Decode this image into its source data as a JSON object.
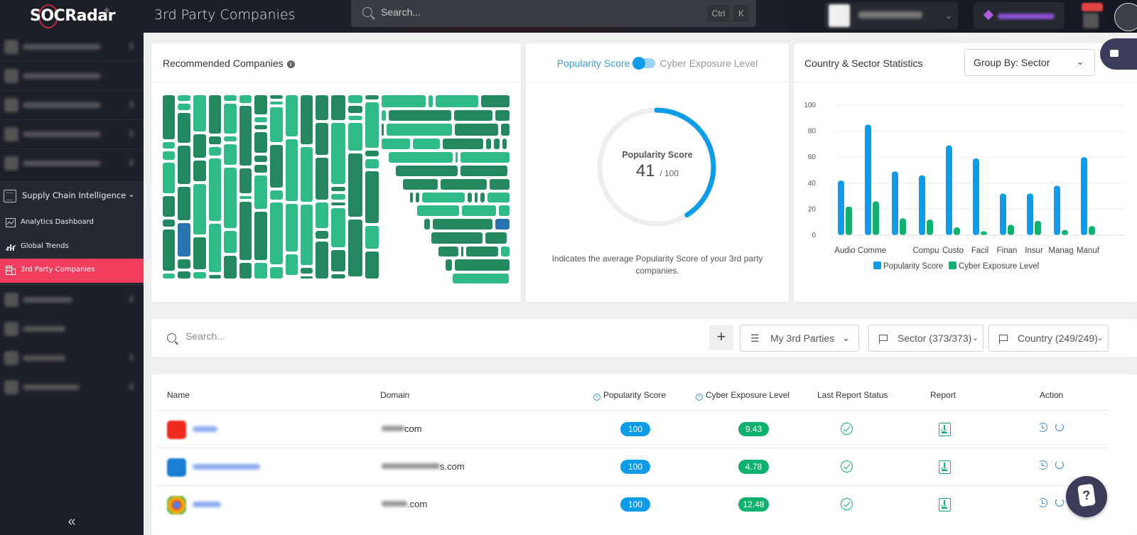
{
  "topbar": {
    "logo": "SOCRadar",
    "logo_mark": "®",
    "page_title": "3rd Party Companies",
    "search_placeholder": "Search...",
    "shortcut_ctrl": "Ctrl",
    "shortcut_key": "K"
  },
  "sidebar": {
    "blurred_items_top": 5,
    "section": {
      "label": "Supply Chain Intelligence",
      "expanded": true
    },
    "sub_items": [
      {
        "label": "Analytics Dashboard",
        "icon": "chart-window-icon",
        "active": false
      },
      {
        "label": "Global Trends",
        "icon": "trend-icon",
        "active": false
      },
      {
        "label": "3rd Party Companies",
        "icon": "building-icon",
        "active": true
      }
    ],
    "blurred_items_bottom": 4,
    "collapse_label": "«"
  },
  "recommended": {
    "title": "Recommended Companies",
    "info": "i"
  },
  "score_card": {
    "toggle_left": "Popularity Score",
    "toggle_right": "Cyber Exposure Level",
    "gauge_label": "Popularity Score",
    "value": "41",
    "max": "/ 100",
    "value_fraction": 0.41,
    "description": "Indicates the average Popularity Score of your 3rd party companies.",
    "colors": {
      "arc": "#0e9be8",
      "track": "#eeeeee"
    }
  },
  "stats_card": {
    "title": "Country & Sector Statistics",
    "group_by": "Group By: Sector"
  },
  "chart_data": {
    "type": "bar",
    "title": "Country & Sector Statistics",
    "categories": [
      "Audio",
      "Comme",
      "",
      "Compu",
      "Custo",
      "Facil",
      "Finan",
      "Insur",
      "Manag",
      "Manuf"
    ],
    "series": [
      {
        "name": "Popularity Score",
        "color": "#0e9be8",
        "values": [
          42,
          85,
          49,
          46,
          69,
          59,
          32,
          32,
          38,
          60
        ]
      },
      {
        "name": "Cyber Exposure Level",
        "color": "#10b06e",
        "values": [
          22,
          26,
          13,
          12,
          6,
          3,
          8,
          11,
          4,
          7
        ]
      }
    ],
    "ylim": [
      0,
      100
    ],
    "yticks": [
      0,
      20,
      40,
      60,
      80,
      100
    ],
    "grid": true,
    "legend": "bottom"
  },
  "filters": {
    "search_placeholder": "Search...",
    "add_label": "+",
    "my_parties": "My 3rd Parties",
    "sector": "Sector (373/373)",
    "country": "Country (249/249)"
  },
  "table": {
    "headers": {
      "name": "Name",
      "domain": "Domain",
      "popularity": "Popularity Score",
      "cyber": "Cyber Exposure Level",
      "status": "Last Report Status",
      "report": "Report",
      "action": "Action"
    },
    "rows": [
      {
        "domain_suffix": "com",
        "popularity": "100",
        "cyber": "9.43",
        "logo_color": "#ee2a1f"
      },
      {
        "domain_suffix": "s.com",
        "popularity": "100",
        "cyber": "4.78",
        "logo_color": "#1a7fd1"
      },
      {
        "domain_suffix": ".com",
        "popularity": "100",
        "cyber": "12.48",
        "logo_color": "#ea4335"
      }
    ]
  },
  "help": {
    "label": "?"
  }
}
